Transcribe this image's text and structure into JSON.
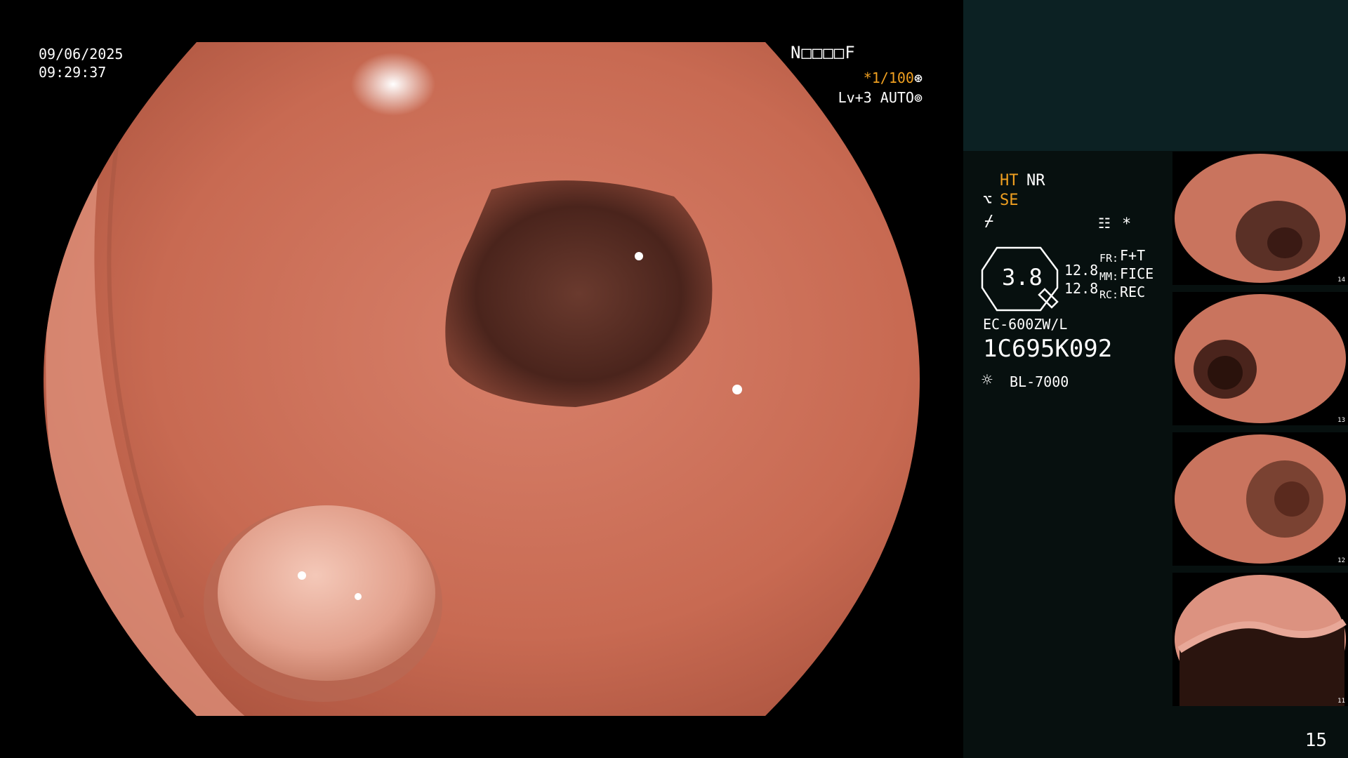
{
  "overlay": {
    "date": "09/06/2025",
    "time": "09:29:37",
    "patient_id": "N□□□□F",
    "shutter_prefix": "*1/100",
    "shutter_icon": "aperture-icon",
    "iris": "Lv+3 AUTO",
    "iris_icon": "iris-icon"
  },
  "panel": {
    "ht": "HT",
    "nr": "NR",
    "se": "SE",
    "zoom": "3.8",
    "left_vals": [
      "12.8",
      "12.8"
    ],
    "labels": [
      "FR:",
      "MM:",
      "RC:"
    ],
    "values": [
      "F+T",
      "FICE",
      "REC"
    ],
    "scope_model": "EC-600ZW/L",
    "serial": "1C695K092",
    "light_source": "BL-7000",
    "asterisk": "*"
  },
  "thumbnails": [
    {
      "index": "14"
    },
    {
      "index": "13"
    },
    {
      "index": "12"
    },
    {
      "index": "11"
    }
  ],
  "page_number": "15",
  "colors": {
    "mucosa": "#c86a52",
    "lumen": "#4a241c",
    "panel_bg": "#07100f",
    "panel_top": "#0c2123",
    "accent": "#f0a020"
  }
}
